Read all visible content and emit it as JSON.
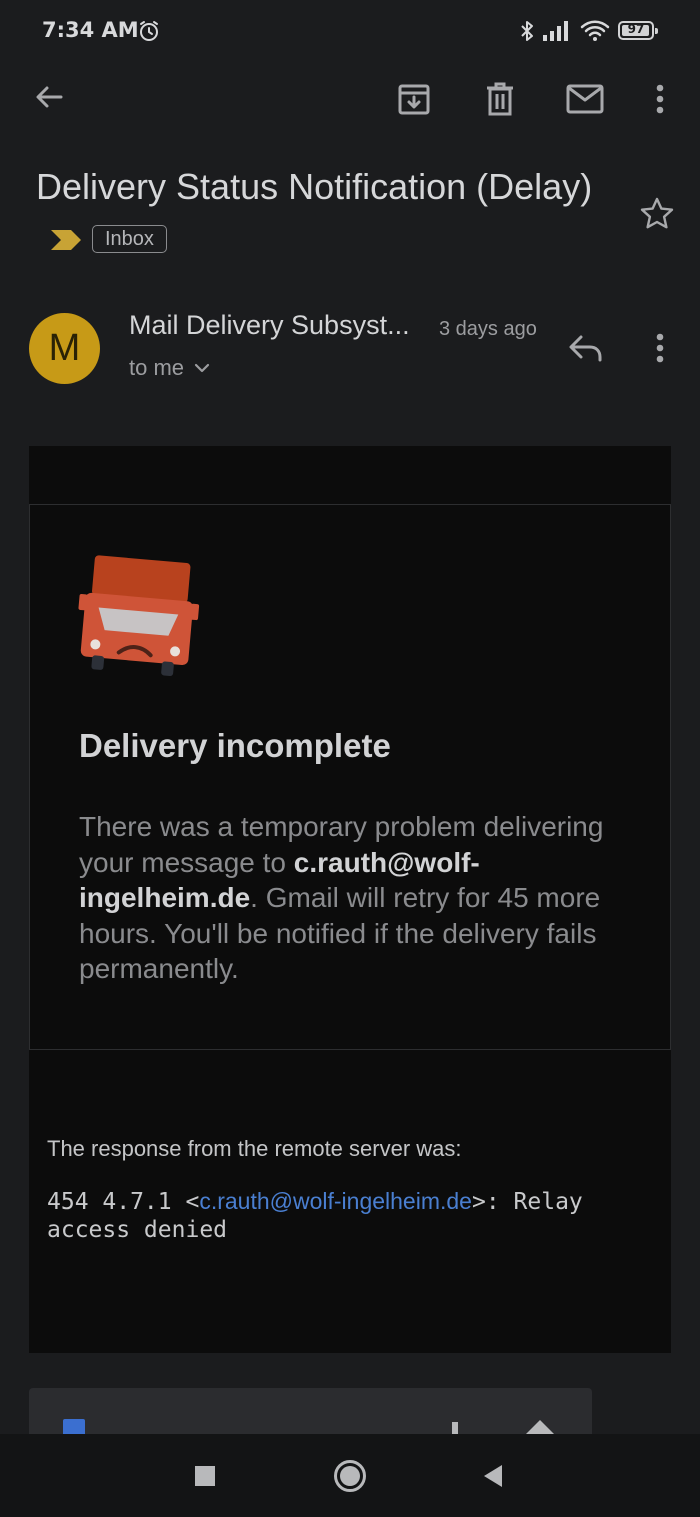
{
  "status_bar": {
    "time": "7:34 AM",
    "battery": "97",
    "battery_level": 0.97
  },
  "toolbar": {
    "icons": [
      "back-arrow-icon",
      "archive-icon",
      "trash-icon",
      "mark-unread-icon",
      "more-vert-icon"
    ]
  },
  "email": {
    "subject": "Delivery Status Notification (Delay)",
    "label": "Inbox",
    "sender": {
      "avatar_letter": "M",
      "avatar_color": "#c79a17",
      "name": "Mail Delivery Subsyst...",
      "time": "3 days ago",
      "recipients": "to me"
    },
    "card": {
      "title": "Delivery incomplete",
      "text_before": "There was a temporary problem delivering your message to ",
      "address": "c.rauth@wolf-ingelheim.de",
      "text_after": ". Gmail will retry for 45 more hours. You'll be notified if the delivery fails permanently."
    },
    "response": {
      "label": "The response from the remote server was:",
      "code_prefix": "454 4.7.1 <",
      "code_link": "c.rauth@wolf-ingelheim.de",
      "code_suffix": ">: Relay access denied"
    }
  },
  "colors": {
    "background": "#1b1c1e",
    "message_bg": "#0c0c0c",
    "link": "#4a7fd1",
    "importance": "#c8a335"
  }
}
